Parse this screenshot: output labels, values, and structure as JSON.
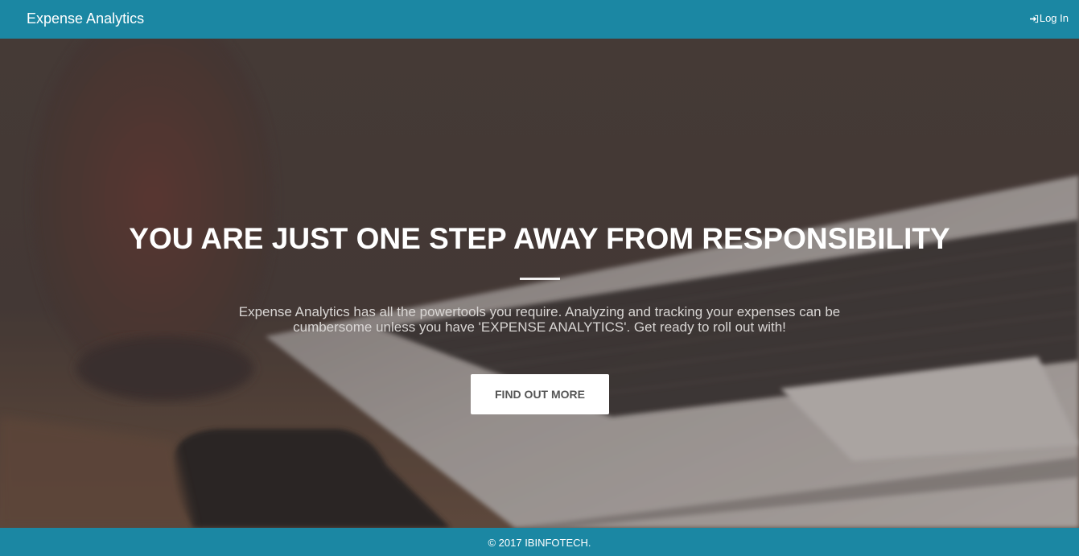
{
  "navbar": {
    "brand": "Expense Analytics",
    "login_label": "Log In",
    "login_icon": "sign-in-icon",
    "color": "#1b87a3"
  },
  "hero": {
    "headline": "YOU ARE JUST ONE STEP AWAY FROM RESPONSIBILITY",
    "subtext": "Expense Analytics has all the powertools you require. Analyzing and tracking your expenses can be cumbersome unless you have 'EXPENSE ANALYTICS'. Get ready to roll out with!",
    "cta_label": "FIND OUT MORE"
  },
  "footer": {
    "copyright": "© 2017 IBINFOTECH."
  }
}
